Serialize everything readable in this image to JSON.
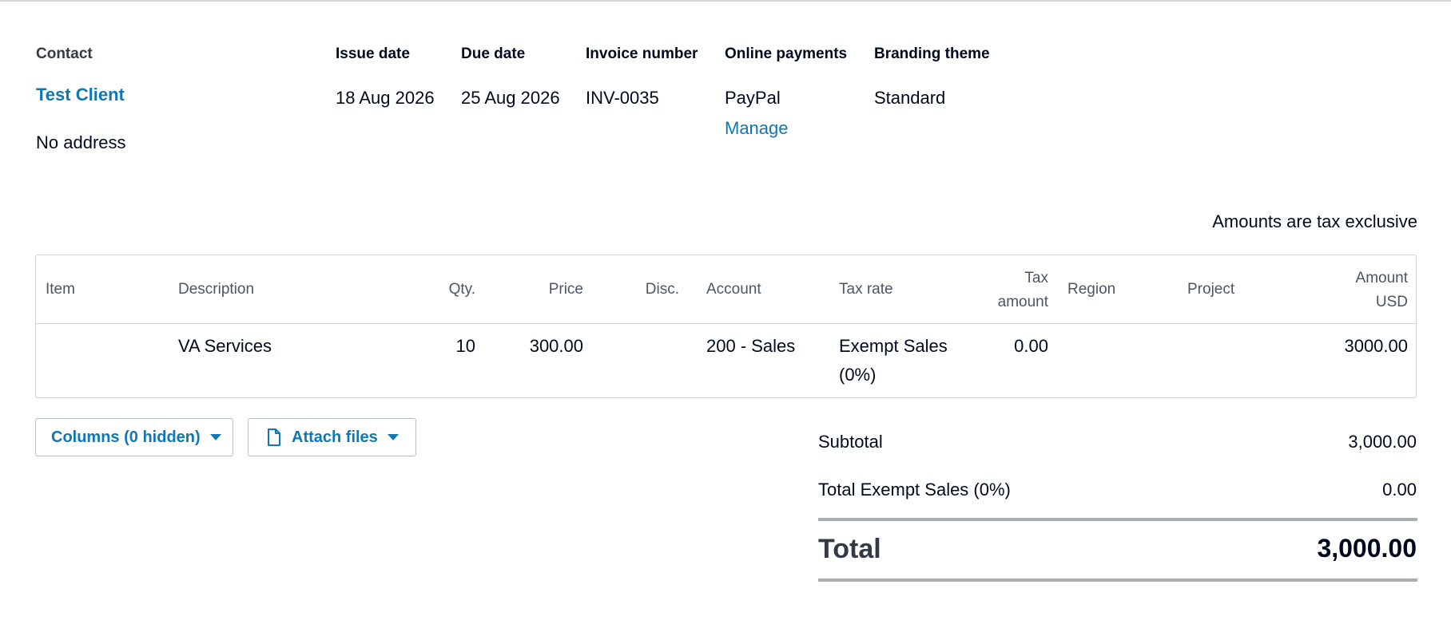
{
  "header": {
    "contact_label": "Contact",
    "contact_name": "Test Client",
    "address": "No address",
    "issue_date_label": "Issue date",
    "issue_date": "18 Aug 2026",
    "due_date_label": "Due date",
    "due_date": "25 Aug 2026",
    "invoice_number_label": "Invoice number",
    "invoice_number": "INV-0035",
    "online_payments_label": "Online payments",
    "online_payments": "PayPal",
    "manage_label": "Manage",
    "branding_theme_label": "Branding theme",
    "branding_theme": "Standard"
  },
  "tax_note": "Amounts are tax exclusive",
  "table": {
    "headers": {
      "item": "Item",
      "description": "Description",
      "qty": "Qty.",
      "price": "Price",
      "disc": "Disc.",
      "account": "Account",
      "tax_rate": "Tax rate",
      "tax_amount_line1": "Tax",
      "tax_amount_line2": "amount",
      "region": "Region",
      "project": "Project",
      "amount_line1": "Amount",
      "amount_line2": "USD"
    },
    "rows": [
      {
        "item": "",
        "description": "VA Services",
        "qty": "10",
        "price": "300.00",
        "disc": "",
        "account": "200 - Sales",
        "tax_rate_line1": "Exempt Sales",
        "tax_rate_line2": "(0%)",
        "tax_amount": "0.00",
        "region": "",
        "project": "",
        "amount": "3000.00"
      }
    ]
  },
  "buttons": {
    "columns_label": "Columns (0 hidden)",
    "attach_label": "Attach files"
  },
  "totals": {
    "subtotal_label": "Subtotal",
    "subtotal": "3,000.00",
    "tax_label": "Total Exempt Sales (0%)",
    "tax": "0.00",
    "total_label": "Total",
    "total": "3,000.00"
  },
  "colors": {
    "link": "#0f78b4",
    "text": "#000a1e",
    "border": "#cdd1d6"
  }
}
